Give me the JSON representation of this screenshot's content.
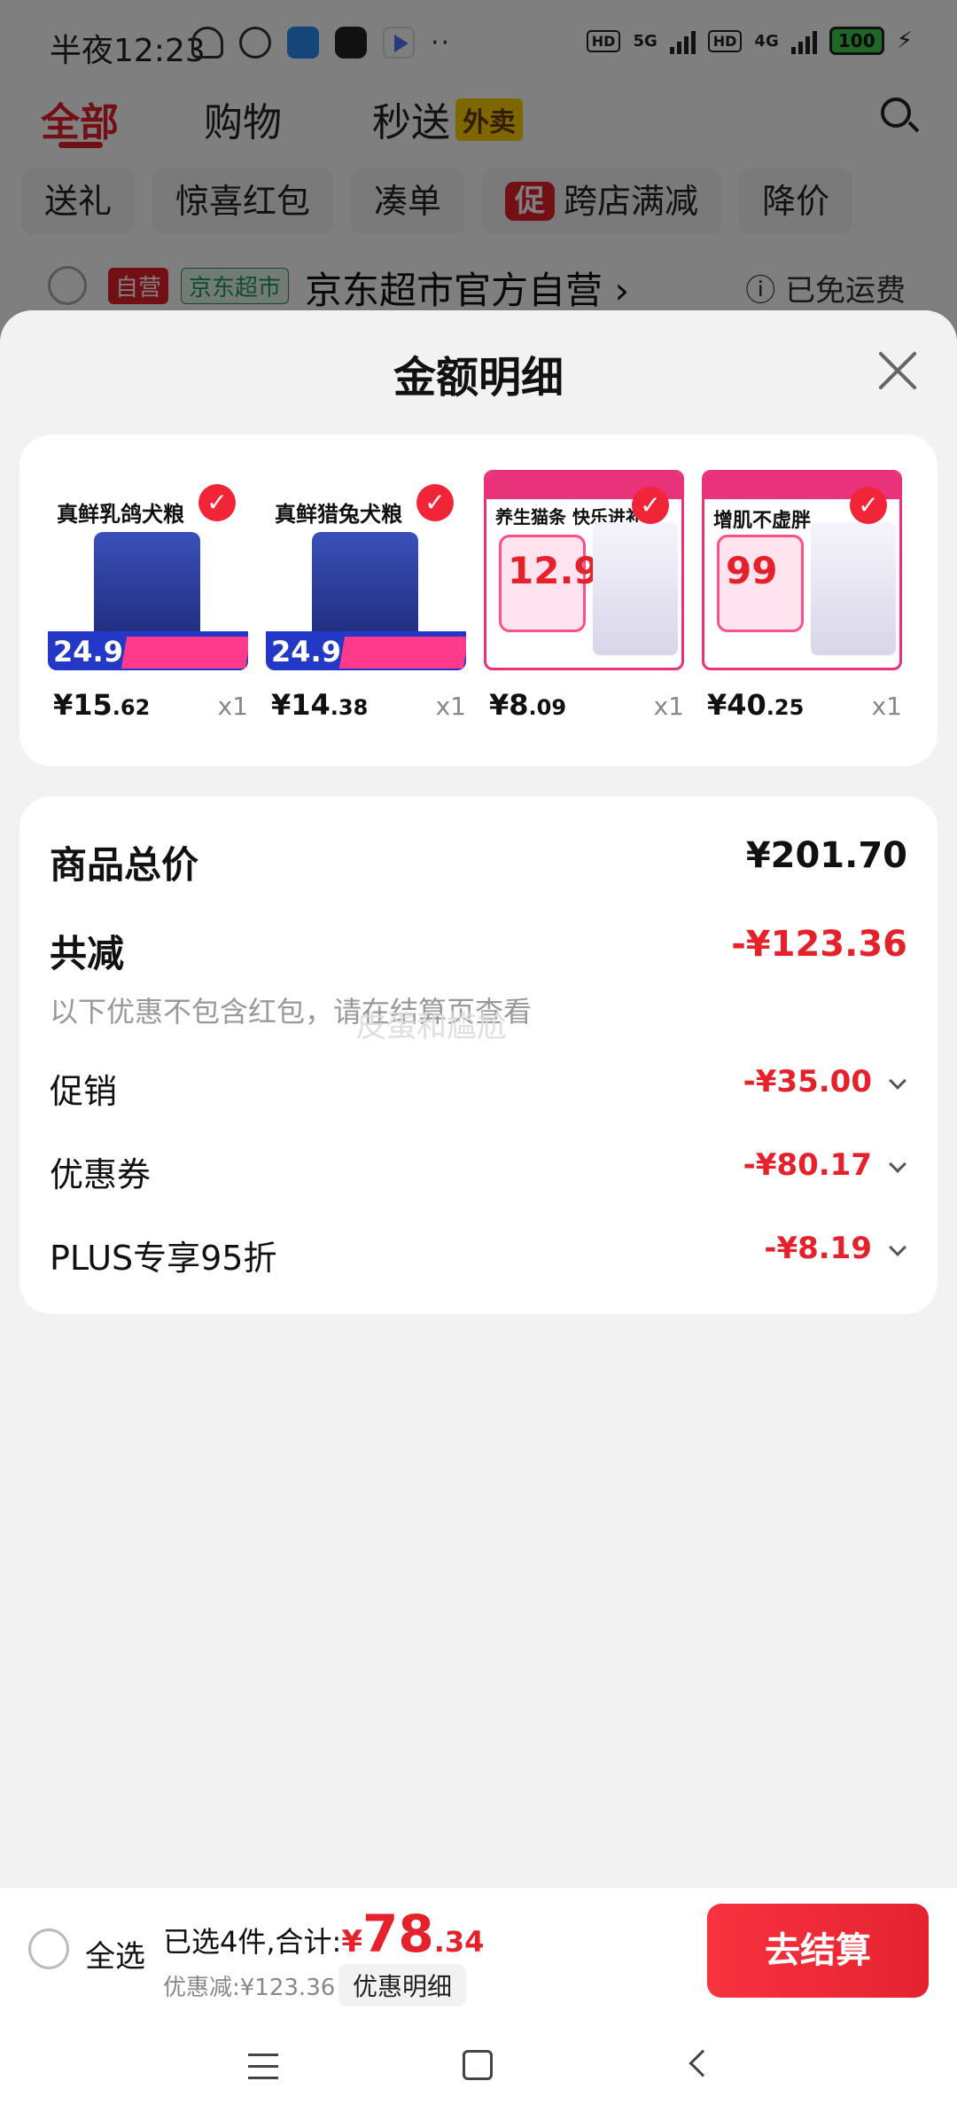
{
  "status_bar": {
    "time": "半夜12:23",
    "dots": "··",
    "hd1": "HD",
    "net1": "5G",
    "hd2": "HD",
    "net2": "4G",
    "battery": "100"
  },
  "top_tabs": {
    "all": "全部",
    "shopping": "购物",
    "instant": "秒送",
    "takeout_badge": "外卖"
  },
  "filter_chips": [
    "送礼",
    "惊喜红包",
    "凑单",
    "跨店满减",
    "降价"
  ],
  "promo_tag": "促",
  "store": {
    "self_tag": "自营",
    "channel_tag": "京东超市",
    "name": "京东超市官方自营",
    "arrow": "›",
    "shipping": "ⓘ 已免运费"
  },
  "sheet": {
    "title": "金额明细"
  },
  "products": [
    {
      "heading": "真鲜乳鸽犬粮",
      "badge_price": "24.9",
      "price_int": "¥15",
      "price_dec": ".62",
      "qty": "x1",
      "style": "blue"
    },
    {
      "heading": "真鲜猎兔犬粮",
      "badge_price": "24.9",
      "price_int": "¥14",
      "price_dec": ".38",
      "qty": "x1",
      "style": "blue"
    },
    {
      "heading": "养生猫条 快乐进补",
      "badge_price": "12.9",
      "price_int": "¥8",
      "price_dec": ".09",
      "qty": "x1",
      "style": "pink"
    },
    {
      "heading": "增肌不虚胖",
      "badge_price": "99",
      "price_int": "¥40",
      "price_dec": ".25",
      "qty": "x1",
      "style": "pink"
    }
  ],
  "summary": {
    "total_label": "商品总价",
    "total_value": "¥201.70",
    "reduce_label": "共减",
    "reduce_value": "-¥123.36",
    "note": "以下优惠不包含红包，请在结算页查看",
    "watermark": "皮蛋和尴尬",
    "promo_label": "促销",
    "promo_value": "-¥35.00",
    "coupon_label": "优惠券",
    "coupon_value": "-¥80.17",
    "plus_label": "PLUS专享95折",
    "plus_value": "-¥8.19"
  },
  "bottom_bar": {
    "select_all": "全选",
    "selected_text": "已选4件,合计:",
    "total_yen": "¥",
    "total_int": "78",
    "total_dec": ".34",
    "discount_text": "优惠减:¥123.36",
    "detail_link": "优惠明细",
    "checkout": "去结算"
  },
  "colors": {
    "accent": "#e5212b",
    "checkout": "#f8323f"
  }
}
